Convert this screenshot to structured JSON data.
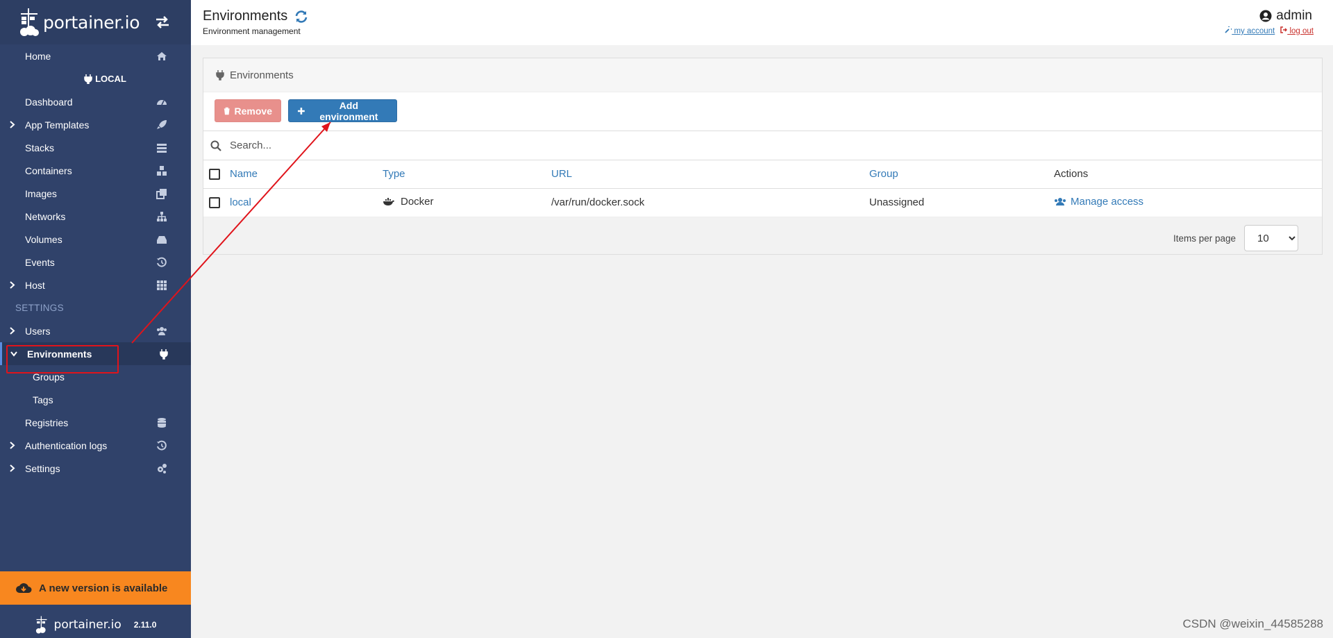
{
  "brand": {
    "name": "portainer.io"
  },
  "sidebar": {
    "items": [
      {
        "label": "Home",
        "icon": "home-icon"
      },
      {
        "label": "LOCAL",
        "icon": "plug-icon"
      },
      {
        "label": "Dashboard",
        "icon": "tachometer-icon"
      },
      {
        "label": "App Templates",
        "icon": "rocket-icon"
      },
      {
        "label": "Stacks",
        "icon": "list-icon"
      },
      {
        "label": "Containers",
        "icon": "cubes-icon"
      },
      {
        "label": "Images",
        "icon": "clone-icon"
      },
      {
        "label": "Networks",
        "icon": "sitemap-icon"
      },
      {
        "label": "Volumes",
        "icon": "hdd-icon"
      },
      {
        "label": "Events",
        "icon": "history-icon"
      },
      {
        "label": "Host",
        "icon": "th-icon"
      },
      {
        "label": "SETTINGS"
      },
      {
        "label": "Users",
        "icon": "users-icon"
      },
      {
        "label": "Environments",
        "icon": "plug-icon"
      },
      {
        "label": "Groups"
      },
      {
        "label": "Tags"
      },
      {
        "label": "Registries",
        "icon": "database-icon"
      },
      {
        "label": "Authentication logs",
        "icon": "history-icon"
      },
      {
        "label": "Settings",
        "icon": "cogs-icon"
      }
    ],
    "update_banner": "A new version is available",
    "footer_brand": "portainer.io",
    "version": "2.11.0"
  },
  "header": {
    "title": "Environments",
    "subtitle": "Environment management",
    "user": "admin",
    "my_account": "my account",
    "log_out": "log out"
  },
  "widget": {
    "title": "Environments",
    "remove_label": "Remove",
    "add_label": "Add environment",
    "search_placeholder": "Search...",
    "columns": [
      "Name",
      "Type",
      "URL",
      "Group",
      "Actions"
    ],
    "rows": [
      {
        "name": "local",
        "type": "Docker",
        "url": "/var/run/docker.sock",
        "group": "Unassigned",
        "action": "Manage access"
      }
    ],
    "items_per_page_label": "Items per page",
    "items_per_page": "10"
  },
  "watermark": "CSDN @weixin_44585288",
  "colors": {
    "sidebar": "#30426a",
    "accent": "#337ab7",
    "banner": "#f8871f",
    "annotation": "#e0141b"
  }
}
